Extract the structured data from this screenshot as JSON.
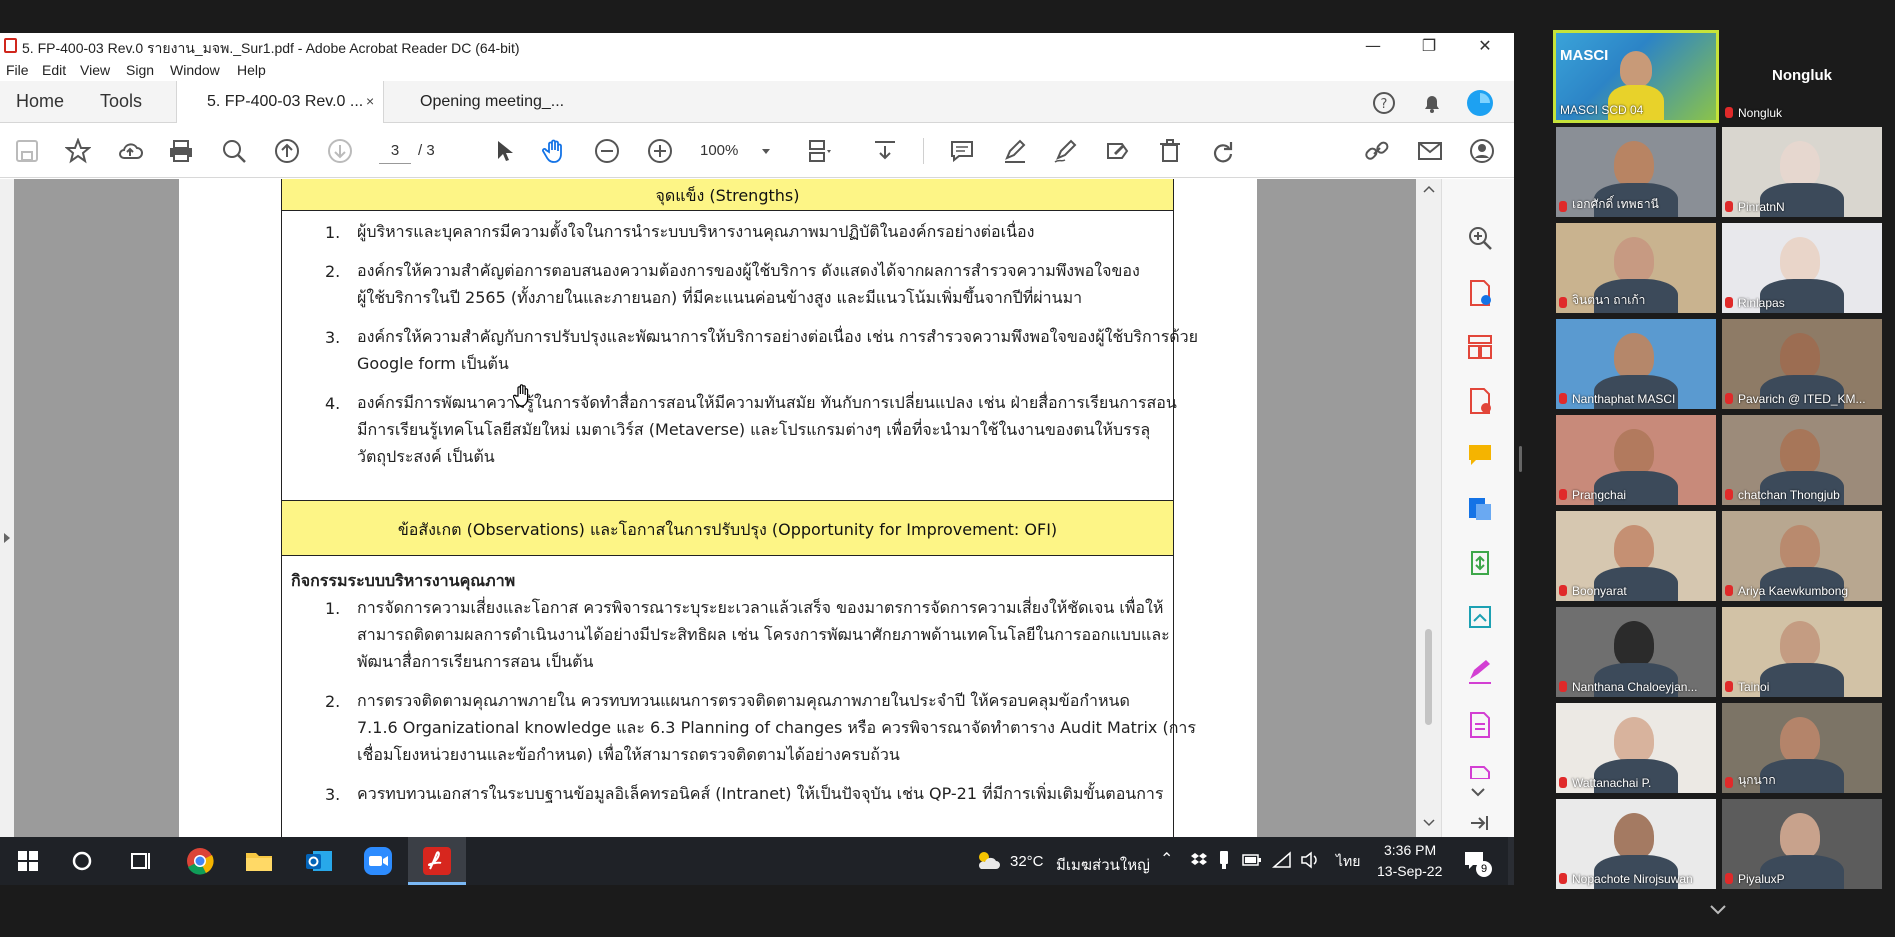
{
  "window": {
    "title": "5. FP-400-03 Rev.0 รายงาน_มจพ._Sur1.pdf - Adobe Acrobat Reader DC (64-bit)",
    "minimize": "—",
    "restore": "❐",
    "close": "✕"
  },
  "menu": [
    "File",
    "Edit",
    "View",
    "Sign",
    "Window",
    "Help"
  ],
  "tabs": {
    "home": "Home",
    "tools": "Tools",
    "doc_active": "5. FP-400-03 Rev.0 ...",
    "doc_close": "×",
    "doc_other": "Opening meeting_..."
  },
  "toolbar": {
    "page_current": "3",
    "page_total": "/  3",
    "zoom": "100%"
  },
  "document": {
    "strengths_header": "จุดแข็ง (Strengths)",
    "strengths": [
      {
        "n": "1.",
        "lines": [
          "ผู้บริหารและบุคลากรมีความตั้งใจในการนำระบบบริหารงานคุณภาพมาปฏิบัติในองค์กรอย่างต่อเนื่อง"
        ]
      },
      {
        "n": "2.",
        "lines": [
          "องค์กรให้ความสำคัญต่อการตอบสนองความต้องการของผู้ใช้บริการ ดังแสดงได้จากผลการสำรวจความพึงพอใจของ",
          "ผู้ใช้บริการในปี 2565 (ทั้งภายในและภายนอก) ที่มีคะแนนค่อนข้างสูง และมีแนวโน้มเพิ่มขึ้นจากปีที่ผ่านมา"
        ]
      },
      {
        "n": "3.",
        "lines": [
          "องค์กรให้ความสำคัญกับการปรับปรุงและพัฒนาการให้บริการอย่างต่อเนื่อง เช่น การสำรวจความพึงพอใจของผู้ใช้บริการด้วย",
          "Google form เป็นต้น"
        ]
      },
      {
        "n": "4.",
        "lines": [
          "องค์กรมีการพัฒนาความรู้ในการจัดทำสื่อการสอนให้มีความทันสมัย ทันกับการเปลี่ยนแปลง เช่น ฝ่ายสื่อการเรียนการสอน",
          "มีการเรียนรู้เทคโนโลยีสมัยใหม่ เมตาเวิร์ส (Metaverse) และโปรแกรมต่างๆ เพื่อที่จะนำมาใช้ในงานของตนให้บรรลุ",
          "วัตถุประสงค์ เป็นต้น"
        ]
      }
    ],
    "ofi_header": "ข้อสังเกต (Observations) และโอกาสในการปรับปรุง (Opportunity for Improvement: OFI)",
    "ofi_subtitle": "กิจกรรมระบบบริหารงานคุณภาพ",
    "ofi": [
      {
        "n": "1.",
        "lines": [
          "การจัดการความเสี่ยงและโอกาส ควรพิจารณาระบุระยะเวลาแล้วเสร็จ ของมาตรการจัดการความเสี่ยงให้ชัดเจน เพื่อให้",
          "สามารถติดตามผลการดำเนินงานได้อย่างมีประสิทธิผล เช่น โครงการพัฒนาศักยภาพด้านเทคโนโลยีในการออกแบบและ",
          "พัฒนาสื่อการเรียนการสอน เป็นต้น"
        ]
      },
      {
        "n": "2.",
        "lines": [
          "การตรวจติดตามคุณภาพภายใน ควรทบทวนแผนการตรวจติดตามคุณภาพภายในประจำปี ให้ครอบคลุมข้อกำหนด",
          "7.1.6 Organizational knowledge และ 6.3 Planning of changes หรือ ควรพิจารณาจัดทำตาราง Audit Matrix (การ",
          "เชื่อมโยงหน่วยงานและข้อกำหนด) เพื่อให้สามารถตรวจติดตามได้อย่างครบถ้วน"
        ]
      },
      {
        "n": "3.",
        "lines": [
          "ควรทบทวนเอกสารในระบบฐานข้อมูลอิเล็คทรอนิคส์ (Intranet) ให้เป็นปัจจุบัน เช่น QP-21 ที่มีการเพิ่มเติมขั้นตอนการ"
        ]
      }
    ]
  },
  "taskbar": {
    "temperature": "32°C",
    "weather": "มีเมฆส่วนใหญ่",
    "language": "ไทย",
    "time": "3:36 PM",
    "date": "13-Sep-22",
    "notifications": "9"
  },
  "meeting": {
    "active_speaker": "MASCI SCD 04",
    "participants": [
      {
        "name": "Nongluk",
        "video": false
      },
      {
        "name": "เอกศักดิ์ เทพธานี",
        "video": true
      },
      {
        "name": "PinratnN",
        "video": true
      },
      {
        "name": "จินตนา ถาเก้า",
        "video": true
      },
      {
        "name": "Rinlapas",
        "video": true
      },
      {
        "name": "Nanthaphat MASCI",
        "video": true
      },
      {
        "name": "Pavarich @ ITED_KM...",
        "video": true
      },
      {
        "name": "Prangchai",
        "video": true
      },
      {
        "name": "chatchan Thongjub",
        "video": true
      },
      {
        "name": "Boonyarat",
        "video": true
      },
      {
        "name": "Ariya Kaewkumbong",
        "video": true
      },
      {
        "name": "Nanthana Chaloeyjan...",
        "video": true
      },
      {
        "name": "Tainoi",
        "video": true
      },
      {
        "name": "Wattanachai P.",
        "video": true
      },
      {
        "name": "นุกนาก",
        "video": true
      },
      {
        "name": "Nopachote Nirojsuwan",
        "video": true
      },
      {
        "name": "PiyaluxP",
        "video": true
      }
    ],
    "masci_label": "MASCI"
  }
}
